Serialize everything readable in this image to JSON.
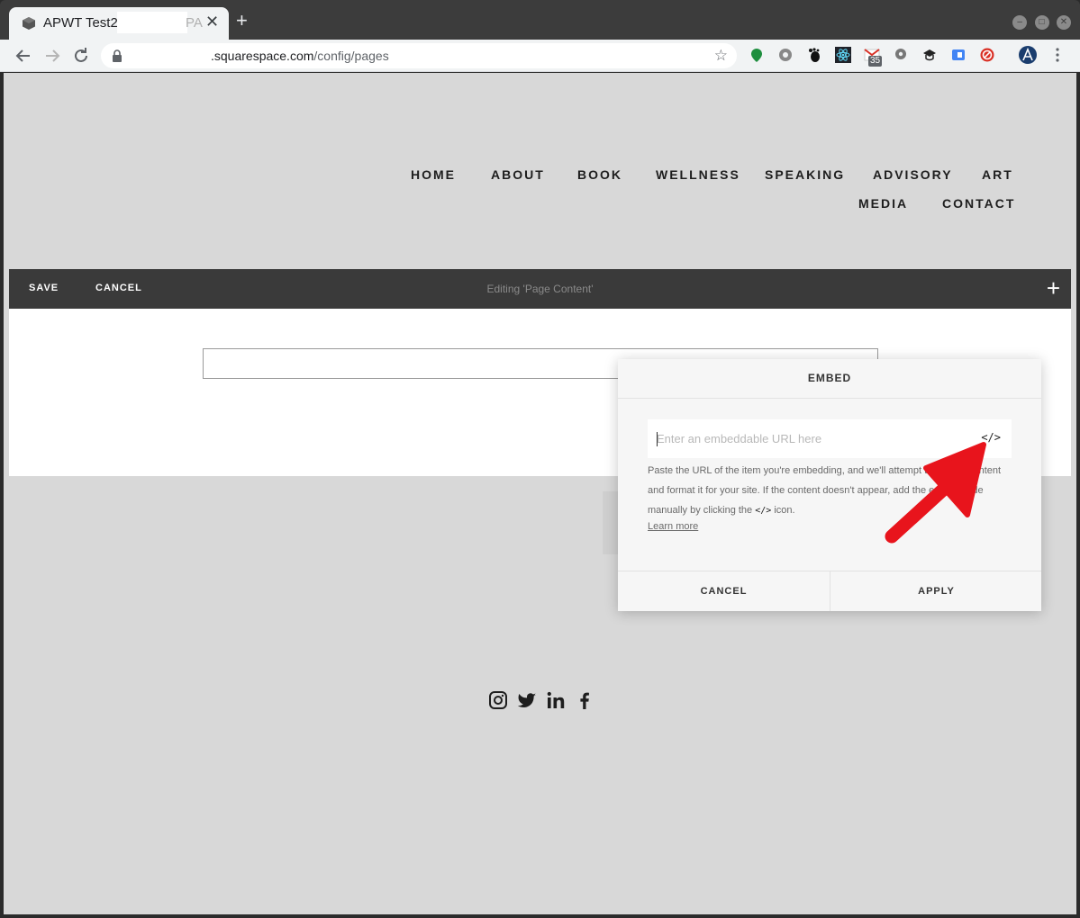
{
  "browser": {
    "tab_title": "APWT Test2",
    "tab_title_fragment": "PA",
    "tab_close": "✕",
    "new_tab": "+",
    "url_domain": ".squarespace.com",
    "url_path": "/config/pages",
    "extension_badge": "35"
  },
  "site_nav": {
    "items": [
      "HOME",
      "ABOUT",
      "BOOK",
      "WELLNESS",
      "SPEAKING",
      "ADVISORY",
      "ART",
      "MEDIA",
      "CONTACT"
    ]
  },
  "edit_bar": {
    "save_label": "SAVE",
    "cancel_label": "CANCEL",
    "status": "Editing 'Page Content'",
    "add_label": "+"
  },
  "embed_dialog": {
    "title": "EMBED",
    "url_placeholder": "Enter an embeddable URL here",
    "code_button_label": "</>",
    "help_part1": "Paste the URL of the item you're embedding, and we'll attempt to get the content and format it for your site. If the content doesn't appear, add the embed code manually by clicking the ",
    "help_code": "</>",
    "help_part2": " icon.",
    "learn_more": "Learn more",
    "cancel_label": "CANCEL",
    "apply_label": "APPLY"
  },
  "colors": {
    "page_background": "#d8d8d8",
    "edit_bar": "#3a3a3a",
    "annotation_arrow": "#e8141c"
  }
}
